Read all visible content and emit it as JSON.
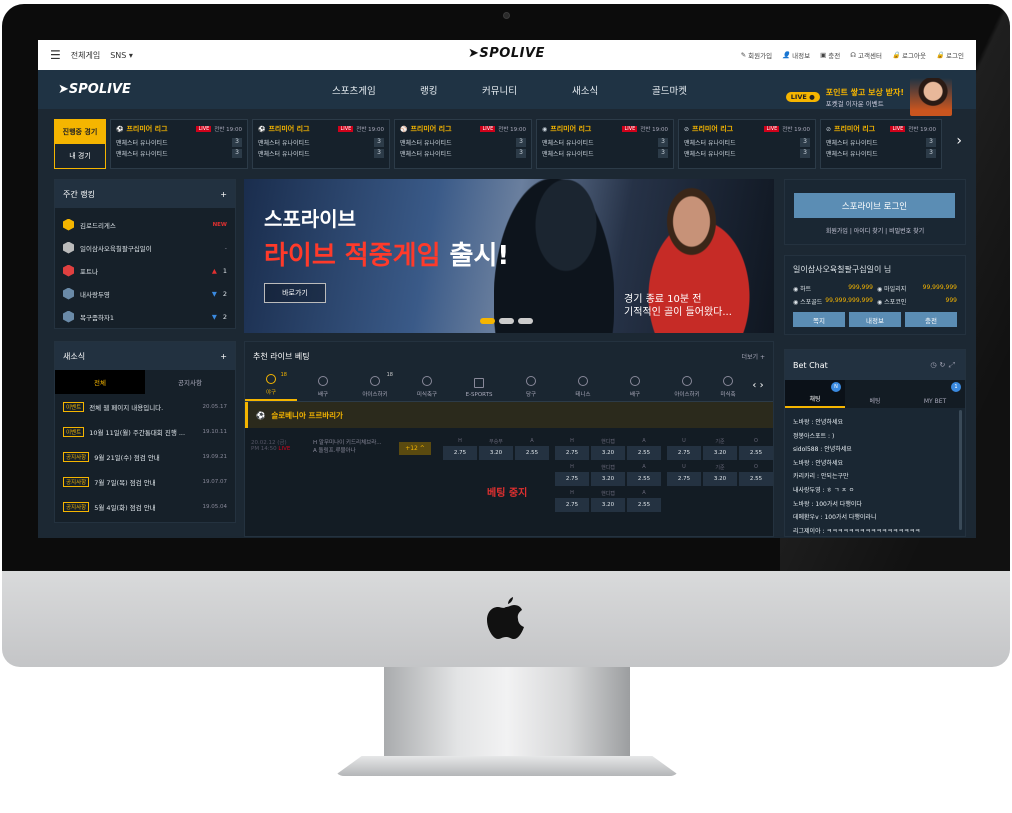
{
  "topbar": {
    "menu_all": "전체게임",
    "menu_sns": "SNS ▾",
    "logo": "SPOLIVE",
    "links": [
      "회원가입",
      "내정보",
      "충전",
      "고객센터",
      "로그아웃",
      "로그인"
    ]
  },
  "nav": {
    "logo": "SPOLIVE",
    "items": [
      "스포츠게임",
      "랭킹",
      "커뮤니티",
      "새소식",
      "골드마켓"
    ],
    "live_badge": "LIVE",
    "promo_title": "포인트 쌓고 보상 받자!",
    "promo_sub": "포켓걸 이자윤 이벤트"
  },
  "match_tabs": [
    "진행중 경기",
    "내 경기"
  ],
  "matches": [
    {
      "league": "프리미어 리그",
      "live": "LIVE",
      "time": "전반 19:00",
      "teams": [
        [
          "맨체스터 유나이티드",
          "3"
        ],
        [
          "맨체스터 유나이티드",
          "3"
        ]
      ]
    },
    {
      "league": "프리미어 리그",
      "live": "LIVE",
      "time": "전반 19:00",
      "teams": [
        [
          "맨체스터 유나이티드",
          "3"
        ],
        [
          "맨체스터 유나이티드",
          "3"
        ]
      ]
    },
    {
      "league": "프리미어 리그",
      "live": "LIVE",
      "time": "전반 19:00",
      "teams": [
        [
          "맨체스터 유나이티드",
          "3"
        ],
        [
          "맨체스터 유나이티드",
          "3"
        ]
      ]
    },
    {
      "league": "프리미어 리그",
      "live": "LIVE",
      "time": "전반 19:00",
      "teams": [
        [
          "맨체스터 유나이티드",
          "3"
        ],
        [
          "맨체스터 유나이티드",
          "3"
        ]
      ]
    },
    {
      "league": "프리미어 리그",
      "live": "LIVE",
      "time": "전반 19:00",
      "teams": [
        [
          "맨체스터 유나이티드",
          "3"
        ],
        [
          "맨체스터 유나이티드",
          "3"
        ]
      ]
    },
    {
      "league": "프리미어 리그",
      "live": "LIVE",
      "time": "전반 19:00",
      "teams": [
        [
          "맨체스터 유나이티드",
          "3"
        ],
        [
          "맨체스터 유나이티드",
          "3"
        ]
      ]
    }
  ],
  "ranking": {
    "title": "주간 랭킹",
    "rows": [
      {
        "name": "김로드리게스",
        "delta": "NEW",
        "color": "#f5b500"
      },
      {
        "name": "일이삼사오육칠팔구십일이",
        "delta": "-",
        "color": "#bbbbbb"
      },
      {
        "name": "포트나",
        "delta": "1",
        "color": "#e04040"
      },
      {
        "name": "내사랑두영",
        "delta": "2",
        "color": "#6a8aa8"
      },
      {
        "name": "복구좀하자1",
        "delta": "2",
        "color": "#6a8aa8"
      }
    ]
  },
  "banner": {
    "line1": "스포라이브",
    "line2_red": "라이브 적중게임",
    "line2_white": " 출시!",
    "button": "바로가기",
    "caption1": "경기 종료 10분 전",
    "caption2": "기적적인 골이 들어왔다..."
  },
  "login": {
    "button": "스포라이브 로그인",
    "links": "회원가입 | 아이디 찾기 | 비밀번호 찾기"
  },
  "user": {
    "name": "일이삼사오육칠팔구십일이 님",
    "stats": [
      {
        "label": "하트",
        "value": "999,999"
      },
      {
        "label": "마일리지",
        "value": "99,999,999"
      },
      {
        "label": "스포골드",
        "value": "99,999,999,999"
      },
      {
        "label": "스포코인",
        "value": "999"
      }
    ],
    "buttons": [
      "쪽지",
      "내정보",
      "충전"
    ]
  },
  "news": {
    "title": "새소식",
    "tabs": [
      "전체",
      "공지사항"
    ],
    "rows": [
      {
        "tag": "이벤트",
        "text": "전체 웹 페이지 내용입니다.",
        "date": "20.05.17"
      },
      {
        "tag": "이벤트",
        "text": "10월 11일(월) 주간통대회 진행 ...",
        "date": "19.10.11"
      },
      {
        "tag": "공지사항",
        "text": "9월 21일(수) 점검 안내",
        "date": "19.09.21"
      },
      {
        "tag": "공지사항",
        "text": "7월 7일(목) 점검 안내",
        "date": "19.07.07"
      },
      {
        "tag": "공지사항",
        "text": "5월 4일(화) 점검 안내",
        "date": "19.05.04"
      }
    ]
  },
  "bet": {
    "title": "추천 라이브 베팅",
    "more": "더보기 +",
    "sports": [
      "야구",
      "배구",
      "아이스하키",
      "미식축구",
      "E-SPORTS",
      "당구",
      "테니스",
      "배구",
      "아이스하키",
      "미식축"
    ],
    "badges": [
      "18",
      "18"
    ],
    "league": "슬로베니아 프르바리가",
    "match_date": "20.02.12 (금)",
    "match_time": "PM 14:50",
    "match_live": "LIVE",
    "team_h": "H  말무미나이 키드리체브라...",
    "team_a": "A  돌림프.루블아나",
    "handicap": "+12 ^",
    "stop": "베팅 중지",
    "heads1": [
      "H",
      "무승부",
      "A"
    ],
    "heads2": [
      "H",
      "핸디캡",
      "A"
    ],
    "heads3": [
      "U",
      "기준",
      "O"
    ],
    "odds": [
      "2.75",
      "3.20",
      "2.55"
    ]
  },
  "chat": {
    "title": "Bet Chat",
    "tabs": [
      "채팅",
      "베팅",
      "MY BET"
    ],
    "badge_n": "N",
    "badge_1": "1",
    "messages": [
      "노바왕 : 안녕하세요",
      "정봉아스포트 : )",
      "sidol588 : 안녕하세요",
      "노바왕 : 안녕하세요",
      "카리카리 : 안되는구만",
      "내사랑두영 : ㅎ ㄱ ㅈ ㅇ",
      "노바왕 : 100가서 다행이다",
      "데메환우v : 100가서 다행이라니",
      "리그제이아 : ㅋㅋㅋㅋㅋㅋㅋㅋㅋㅋㅋㅋㅋㅋㅋㅋㅋ"
    ]
  },
  "colors": {
    "accent": "#f5b500",
    "nav_bg": "#1f3344",
    "button_blue": "#5b8db4",
    "live_red": "#d0021b"
  }
}
